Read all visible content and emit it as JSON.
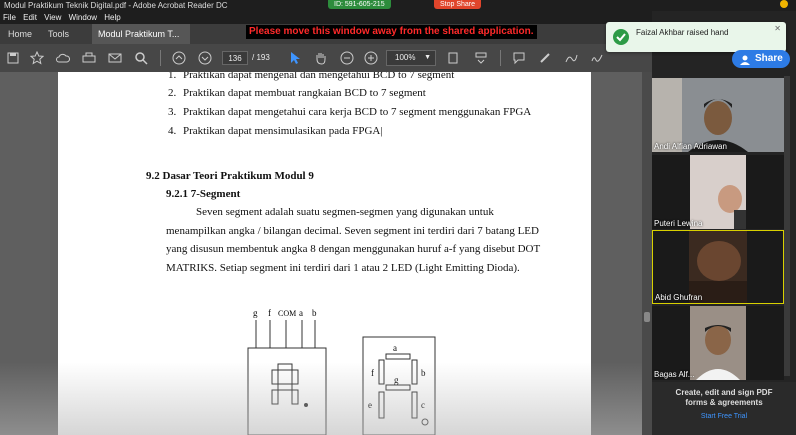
{
  "window": {
    "title": "Modul Praktikum Teknik Digital.pdf - Adobe Acrobat Reader DC",
    "meeting_id": "ID: 591-605-215",
    "stop_share": "Stop Share"
  },
  "menu": [
    "File",
    "Edit",
    "View",
    "Window",
    "Help"
  ],
  "tabs": [
    "Home",
    "Tools",
    "Modul Praktikum T..."
  ],
  "warning": "Please move this window away from the shared application.",
  "toolbar": {
    "page_current": "136",
    "page_total": "/ 193",
    "zoom": "100%"
  },
  "document": {
    "list": [
      {
        "n": "1.",
        "text": "Praktikan dapat mengenal dan mengetahui BCD to 7 segment"
      },
      {
        "n": "2.",
        "text": "Praktikan dapat membuat rangkaian BCD to 7 segment"
      },
      {
        "n": "3.",
        "text": "Praktikan  dapat mengetahui cara kerja BCD to 7 segment menggunakan FPGA"
      },
      {
        "n": "4.",
        "text": "Praktikan dapat mensimulasikan pada FPGA|"
      }
    ],
    "heading": "9.2  Dasar Teori Praktikum Modul  9",
    "subheading": "9.2.1  7-Segment",
    "paragraph": [
      "Seven  segment  adalah  suatu  segmen-segmen  yang  digunakan  untuk",
      "menampilkan angka / bilangan decimal. Seven segment ini terdiri dari 7 batang LED",
      "yang disusun membentuk angka 8 dengan menggunakan huruf a-f yang disebut DOT",
      "MATRIKS. Setiap segment ini terdiri dari 1 atau 2 LED (Light Emitting Dioda)."
    ],
    "figure_pins": [
      "g",
      "f",
      "COM",
      "a",
      "b"
    ],
    "figure_segments": [
      "a",
      "f",
      "g",
      "b",
      "e",
      "c"
    ]
  },
  "notification": "Faizal Akhbar raised hand",
  "share_button": "Share",
  "participants": [
    {
      "name": "Andi Alfian Adriawan"
    },
    {
      "name": "Puteri Lewina"
    },
    {
      "name": "Abid Ghufran"
    },
    {
      "name": "Bagas Alf..."
    }
  ],
  "promo": {
    "line1": "Create, edit and sign PDF",
    "line2": "forms & agreements",
    "link": "Start Free Trial"
  }
}
